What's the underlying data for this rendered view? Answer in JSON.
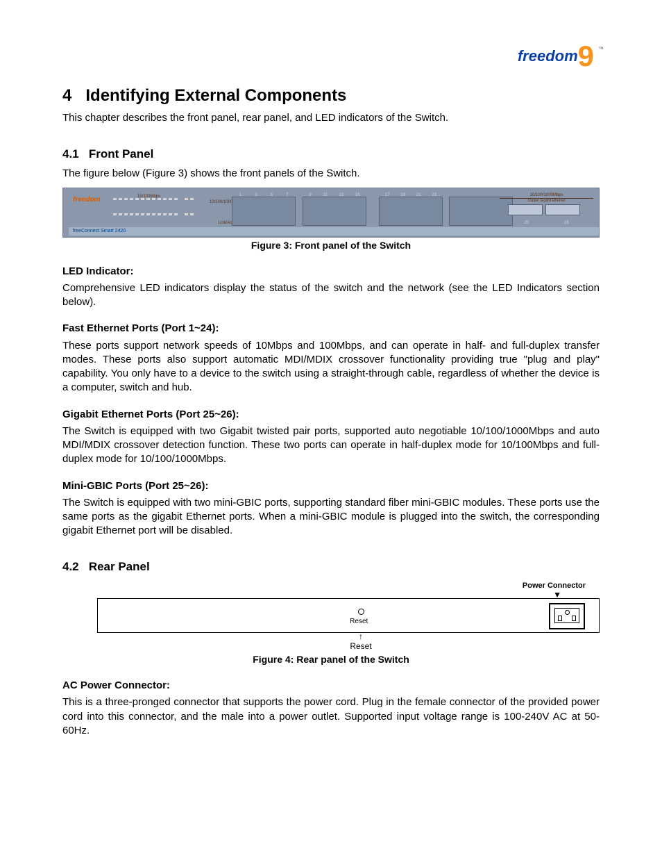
{
  "logo": {
    "brand": "freedom",
    "nine": "9",
    "tm": "™"
  },
  "chapter": {
    "num": "4",
    "title": "Identifying External Components"
  },
  "intro": "This chapter describes the front panel, rear panel, and LED indicators of the Switch.",
  "sec41": {
    "num": "4.1",
    "title": "Front Panel",
    "lead": "The figure below (Figure 3) shows the front panels of the Switch.",
    "figcap": "Figure 3: Front panel of the Switch",
    "fp": {
      "brand": "freedom",
      "model": "freeConnect Smart 2420",
      "speed1": "10/100Mbps",
      "speed2": "10/100/1000Mbps",
      "link": "Link/Act",
      "gbic_top": "10/100/1000Mbps",
      "gbic_sub": "Copper Gigabit Ethernet",
      "nums_a": [
        "1",
        "3",
        "5",
        "7"
      ],
      "nums_b": [
        "9",
        "11",
        "13",
        "15"
      ],
      "nums_c": [
        "17",
        "19",
        "21",
        "23"
      ],
      "nums_d": [],
      "nums_e": [
        "25",
        "26"
      ]
    },
    "led_hd": "LED Indicator:",
    "led_body": "Comprehensive LED indicators display the status of the switch and the network (see the LED Indicators section below).",
    "fe_hd": "Fast Ethernet Ports (Port 1~24):",
    "fe_body": "These ports support network speeds of 10Mbps and 100Mbps, and can operate in half- and full-duplex transfer modes. These ports also support automatic MDI/MDIX crossover functionality providing true \"plug and play\" capability.  You only have to a device to the switch using a straight-through cable, regardless of whether the device is a computer, switch and hub.",
    "ge_hd": "Gigabit Ethernet Ports (Port 25~26):",
    "ge_body": "The Switch is equipped with two Gigabit twisted pair ports, supported auto negotiable 10/100/1000Mbps and auto MDI/MDIX crossover detection function. These two ports can operate in half-duplex mode for 10/100Mbps and full-duplex mode for 10/100/1000Mbps.",
    "mg_hd": "Mini-GBIC Ports (Port 25~26):",
    "mg_body": "The Switch is equipped with two mini-GBIC ports, supporting standard fiber mini-GBIC modules. These ports use the same ports as the gigabit Ethernet ports.  When a mini-GBIC module is plugged into the switch, the corresponding gigabit Ethernet port will be disabled."
  },
  "sec42": {
    "num": "4.2",
    "title": "Rear Panel",
    "powerlbl": "Power Connector",
    "reset_in": "Reset",
    "reset_out": "Reset",
    "figcap": "Figure 4: Rear panel of the Switch",
    "ac_hd": "AC Power Connector:",
    "ac_body": "This is a three-pronged connector that supports the power cord. Plug in the female connector of the provided power cord into this connector, and the male into a power outlet. Supported input voltage range is 100-240V AC at 50-60Hz."
  }
}
